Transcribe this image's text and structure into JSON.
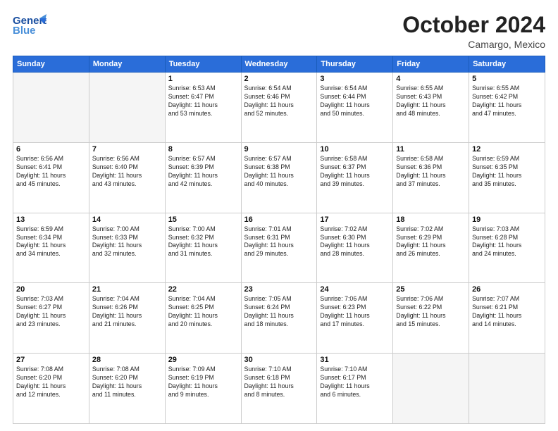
{
  "header": {
    "logo_line1": "General",
    "logo_line2": "Blue",
    "month": "October 2024",
    "location": "Camargo, Mexico"
  },
  "weekdays": [
    "Sunday",
    "Monday",
    "Tuesday",
    "Wednesday",
    "Thursday",
    "Friday",
    "Saturday"
  ],
  "weeks": [
    [
      {
        "day": "",
        "info": ""
      },
      {
        "day": "",
        "info": ""
      },
      {
        "day": "1",
        "info": "Sunrise: 6:53 AM\nSunset: 6:47 PM\nDaylight: 11 hours\nand 53 minutes."
      },
      {
        "day": "2",
        "info": "Sunrise: 6:54 AM\nSunset: 6:46 PM\nDaylight: 11 hours\nand 52 minutes."
      },
      {
        "day": "3",
        "info": "Sunrise: 6:54 AM\nSunset: 6:44 PM\nDaylight: 11 hours\nand 50 minutes."
      },
      {
        "day": "4",
        "info": "Sunrise: 6:55 AM\nSunset: 6:43 PM\nDaylight: 11 hours\nand 48 minutes."
      },
      {
        "day": "5",
        "info": "Sunrise: 6:55 AM\nSunset: 6:42 PM\nDaylight: 11 hours\nand 47 minutes."
      }
    ],
    [
      {
        "day": "6",
        "info": "Sunrise: 6:56 AM\nSunset: 6:41 PM\nDaylight: 11 hours\nand 45 minutes."
      },
      {
        "day": "7",
        "info": "Sunrise: 6:56 AM\nSunset: 6:40 PM\nDaylight: 11 hours\nand 43 minutes."
      },
      {
        "day": "8",
        "info": "Sunrise: 6:57 AM\nSunset: 6:39 PM\nDaylight: 11 hours\nand 42 minutes."
      },
      {
        "day": "9",
        "info": "Sunrise: 6:57 AM\nSunset: 6:38 PM\nDaylight: 11 hours\nand 40 minutes."
      },
      {
        "day": "10",
        "info": "Sunrise: 6:58 AM\nSunset: 6:37 PM\nDaylight: 11 hours\nand 39 minutes."
      },
      {
        "day": "11",
        "info": "Sunrise: 6:58 AM\nSunset: 6:36 PM\nDaylight: 11 hours\nand 37 minutes."
      },
      {
        "day": "12",
        "info": "Sunrise: 6:59 AM\nSunset: 6:35 PM\nDaylight: 11 hours\nand 35 minutes."
      }
    ],
    [
      {
        "day": "13",
        "info": "Sunrise: 6:59 AM\nSunset: 6:34 PM\nDaylight: 11 hours\nand 34 minutes."
      },
      {
        "day": "14",
        "info": "Sunrise: 7:00 AM\nSunset: 6:33 PM\nDaylight: 11 hours\nand 32 minutes."
      },
      {
        "day": "15",
        "info": "Sunrise: 7:00 AM\nSunset: 6:32 PM\nDaylight: 11 hours\nand 31 minutes."
      },
      {
        "day": "16",
        "info": "Sunrise: 7:01 AM\nSunset: 6:31 PM\nDaylight: 11 hours\nand 29 minutes."
      },
      {
        "day": "17",
        "info": "Sunrise: 7:02 AM\nSunset: 6:30 PM\nDaylight: 11 hours\nand 28 minutes."
      },
      {
        "day": "18",
        "info": "Sunrise: 7:02 AM\nSunset: 6:29 PM\nDaylight: 11 hours\nand 26 minutes."
      },
      {
        "day": "19",
        "info": "Sunrise: 7:03 AM\nSunset: 6:28 PM\nDaylight: 11 hours\nand 24 minutes."
      }
    ],
    [
      {
        "day": "20",
        "info": "Sunrise: 7:03 AM\nSunset: 6:27 PM\nDaylight: 11 hours\nand 23 minutes."
      },
      {
        "day": "21",
        "info": "Sunrise: 7:04 AM\nSunset: 6:26 PM\nDaylight: 11 hours\nand 21 minutes."
      },
      {
        "day": "22",
        "info": "Sunrise: 7:04 AM\nSunset: 6:25 PM\nDaylight: 11 hours\nand 20 minutes."
      },
      {
        "day": "23",
        "info": "Sunrise: 7:05 AM\nSunset: 6:24 PM\nDaylight: 11 hours\nand 18 minutes."
      },
      {
        "day": "24",
        "info": "Sunrise: 7:06 AM\nSunset: 6:23 PM\nDaylight: 11 hours\nand 17 minutes."
      },
      {
        "day": "25",
        "info": "Sunrise: 7:06 AM\nSunset: 6:22 PM\nDaylight: 11 hours\nand 15 minutes."
      },
      {
        "day": "26",
        "info": "Sunrise: 7:07 AM\nSunset: 6:21 PM\nDaylight: 11 hours\nand 14 minutes."
      }
    ],
    [
      {
        "day": "27",
        "info": "Sunrise: 7:08 AM\nSunset: 6:20 PM\nDaylight: 11 hours\nand 12 minutes."
      },
      {
        "day": "28",
        "info": "Sunrise: 7:08 AM\nSunset: 6:20 PM\nDaylight: 11 hours\nand 11 minutes."
      },
      {
        "day": "29",
        "info": "Sunrise: 7:09 AM\nSunset: 6:19 PM\nDaylight: 11 hours\nand 9 minutes."
      },
      {
        "day": "30",
        "info": "Sunrise: 7:10 AM\nSunset: 6:18 PM\nDaylight: 11 hours\nand 8 minutes."
      },
      {
        "day": "31",
        "info": "Sunrise: 7:10 AM\nSunset: 6:17 PM\nDaylight: 11 hours\nand 6 minutes."
      },
      {
        "day": "",
        "info": ""
      },
      {
        "day": "",
        "info": ""
      }
    ]
  ]
}
